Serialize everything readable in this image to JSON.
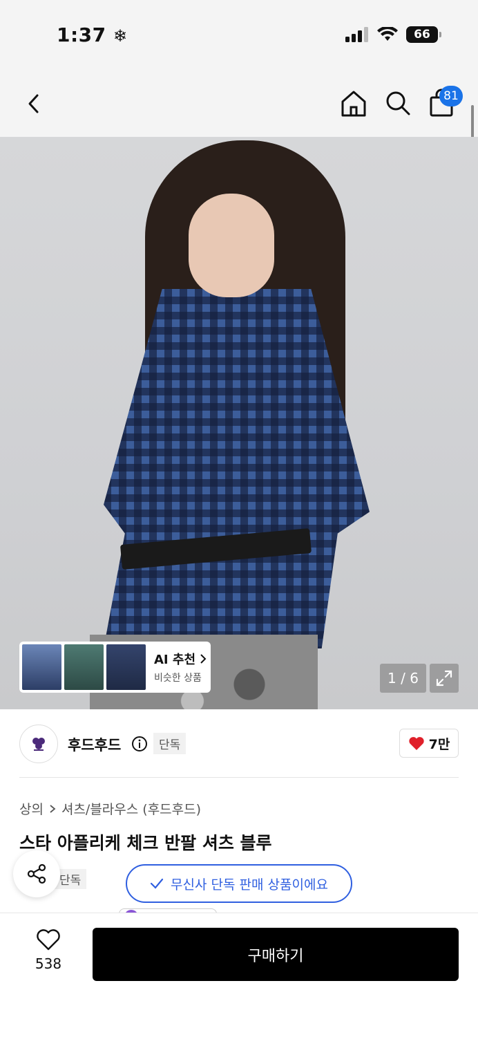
{
  "status_bar": {
    "time": "1:37",
    "battery": "66",
    "time_icon": "snowflake-icon"
  },
  "nav": {
    "back_icon": "chevron-left-icon",
    "cart_badge": "81"
  },
  "gallery": {
    "counter": "1 / 6",
    "ai_card": {
      "title": "AI 추천",
      "subtitle": "비슷한 상품"
    }
  },
  "brand": {
    "name": "후드후드",
    "exclusive_tag": "단독",
    "like_count": "7만"
  },
  "product": {
    "breadcrumb_category": "상의",
    "breadcrumb_sub": "셔츠/블라우스 (후드후드)",
    "title": "스타 아플리케 체크 반팔 셔츠 블루",
    "exclusive_tag": "단독"
  },
  "toast": {
    "text": "무신사 단독 판매 상품이에요"
  },
  "bottom_bar": {
    "wish_count": "538",
    "buy_label": "구매하기"
  },
  "colors": {
    "accent_blue": "#2f5fe0",
    "badge_blue": "#1a73e8",
    "heart_red": "#e0202a",
    "buy_button": "#000000"
  }
}
